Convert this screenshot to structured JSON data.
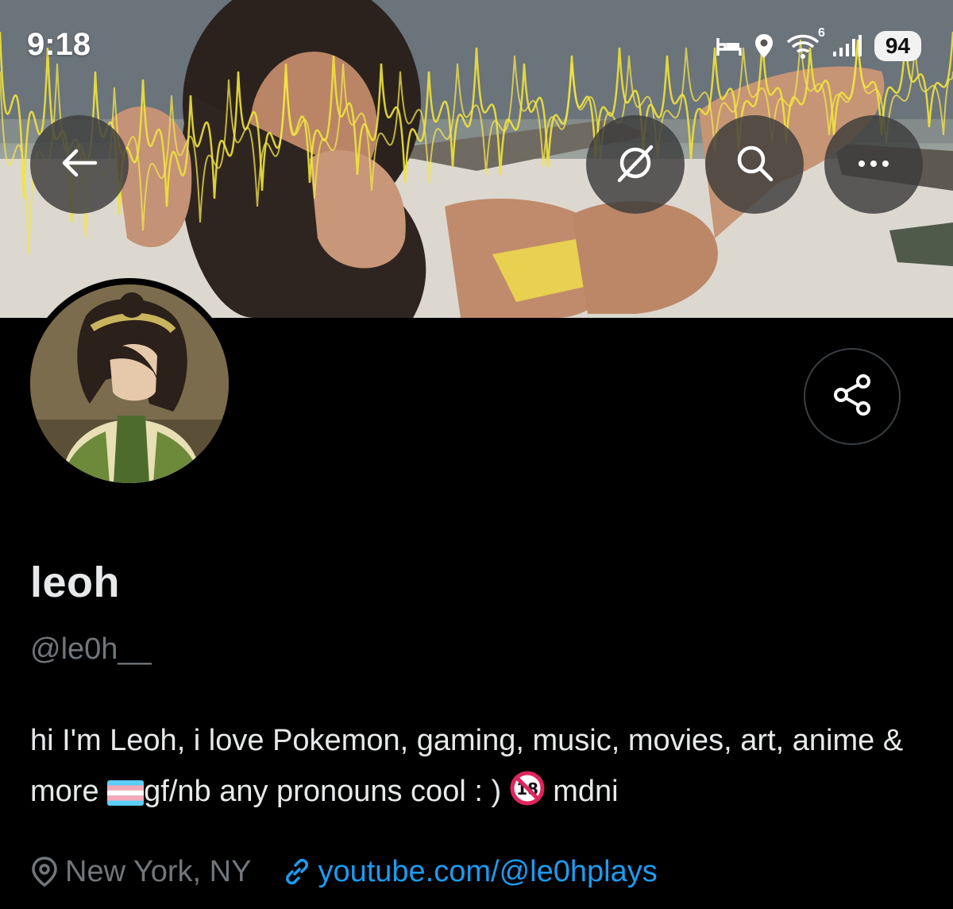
{
  "status_bar": {
    "time": "9:18",
    "network_generation": "6",
    "battery_level": "94",
    "icons": [
      "sleep-mode-icon",
      "location-icon",
      "wifi-icon",
      "signal-icon",
      "battery-icon"
    ]
  },
  "header_actions": {
    "back": "back-arrow-icon",
    "grok": "grok-icon",
    "search": "search-icon",
    "more": "more-icon"
  },
  "profile": {
    "display_name": "leoh",
    "handle": "@le0h__",
    "bio_part1": "hi I'm Leoh, i love Pokemon, gaming, music, movies, art, anime & more ",
    "bio_part2": "gf/nb any pronouns cool : ) ",
    "bio_part3": " mdni",
    "bio_emojis": [
      "transgender-flag-emoji",
      "no-one-under-eighteen-emoji"
    ],
    "location": "New York, NY",
    "website": "youtube.com/@le0hplays"
  },
  "colors": {
    "background": "#000000",
    "primary_text": "#e7e9ea",
    "secondary_text": "#71767b",
    "link": "#1d9bf0",
    "button_overlay": "#3c3c3c"
  }
}
